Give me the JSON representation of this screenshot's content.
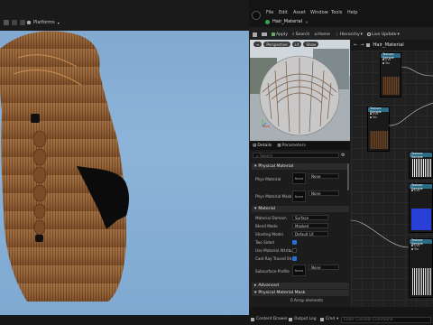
{
  "viewport": {
    "toolbar_label": "Platforms",
    "colors": {
      "sky": "#8db4d8",
      "hair": "#8a5a33"
    }
  },
  "editor": {
    "menu": [
      "File",
      "Edit",
      "Asset",
      "Window",
      "Tools",
      "Help"
    ],
    "tab_title": "Hair_Material",
    "toolbar": {
      "save": "",
      "browse": "",
      "apply": "Apply",
      "search": "Search",
      "home": "Home",
      "hierarchy": "Hierarchy",
      "live_update": "Live Update"
    },
    "preview": {
      "perspective": "Perspective",
      "lit": "Lit",
      "show": "Show"
    },
    "details": {
      "tab_details": "Details",
      "tab_parameters": "Parameters",
      "search_placeholder": "Search",
      "categories": {
        "physical_material": "Physical Material",
        "material": "Material",
        "advanced": "Advanced",
        "physical_material_mask": "Physical Material Mask"
      },
      "props": {
        "phys_material": "Phys Material",
        "phys_material_value": "None",
        "phys_material_mask": "Phys Material Mask",
        "phys_material_mask_value": "None",
        "material_domain": "Material Domain",
        "material_domain_value": "Surface",
        "blend_mode": "Blend Mode",
        "blend_mode_value": "Masked",
        "shading_model": "Shading Model",
        "shading_model_value": "Default Lit",
        "two_sided": "Two Sided",
        "use_material_attribs": "Use Material Attribu..",
        "cast_ray_traced": "Cast Ray Traced Sh..",
        "subsurface_profile": "Subsurface Profile",
        "subsurface_value": "None",
        "none_chip": "None",
        "array_elements": "0 Array elements"
      }
    },
    "graph": {
      "tab_title": "Hair_Material",
      "nodes": [
        {
          "title": "Texture Sample"
        },
        {
          "title": "Texture Sample"
        },
        {
          "title": "Texture Sample"
        },
        {
          "title": "Texture Sample"
        },
        {
          "title": "Texture Sample"
        }
      ],
      "pins": [
        "UVs",
        "Tex",
        "RGB",
        "R",
        "G",
        "B",
        "A",
        "RGBA"
      ]
    }
  },
  "bottombar": {
    "content_drawer": "Content Drawer",
    "output_log": "Output Log",
    "cmd": "Cmd",
    "console_placeholder": "Enter Console Command"
  }
}
